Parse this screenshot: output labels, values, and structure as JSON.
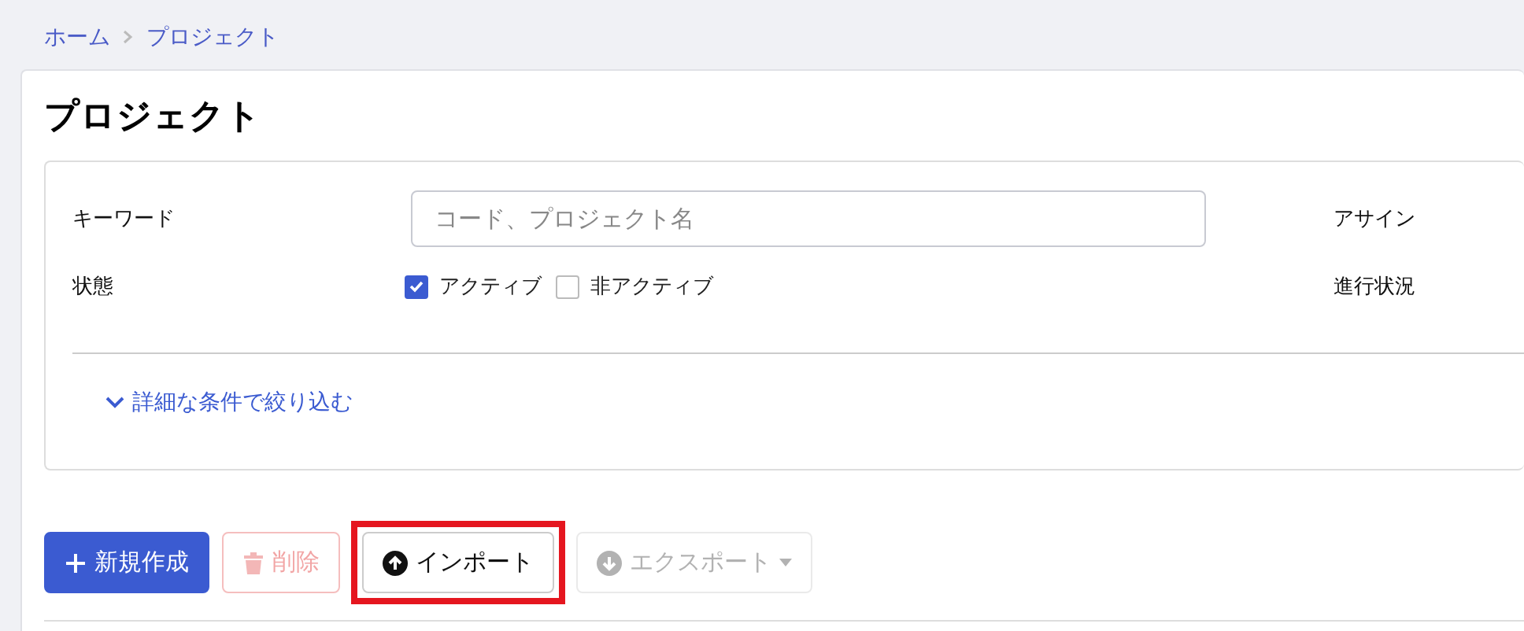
{
  "breadcrumb": [
    {
      "label": "ホーム"
    },
    {
      "label": "プロジェクト"
    }
  ],
  "title": "プロジェクト",
  "filters": [
    {
      "label": "キーワード",
      "kind": "text",
      "placeholder": "コード、プロジェクト名"
    },
    {
      "label": "アサイン",
      "kind": "label"
    },
    {
      "label": "状態",
      "kind": "checkboxes",
      "options": [
        {
          "label": "アクティブ",
          "checked": true
        },
        {
          "label": "非アクティブ",
          "checked": false
        }
      ]
    },
    {
      "label": "進行状況",
      "kind": "label"
    }
  ],
  "more_filters": {
    "label": "詳細な条件で絞り込む",
    "expanded": false
  },
  "buttons": [
    {
      "kind": "create",
      "label": "新規作成",
      "disabled": false,
      "highlighted": false
    },
    {
      "kind": "delete",
      "label": "削除",
      "disabled": true,
      "highlighted": false
    },
    {
      "kind": "import",
      "label": "インポート",
      "disabled": false,
      "highlighted": true
    },
    {
      "kind": "export",
      "label": "エクスポート",
      "disabled": true,
      "highlighted": false
    }
  ]
}
